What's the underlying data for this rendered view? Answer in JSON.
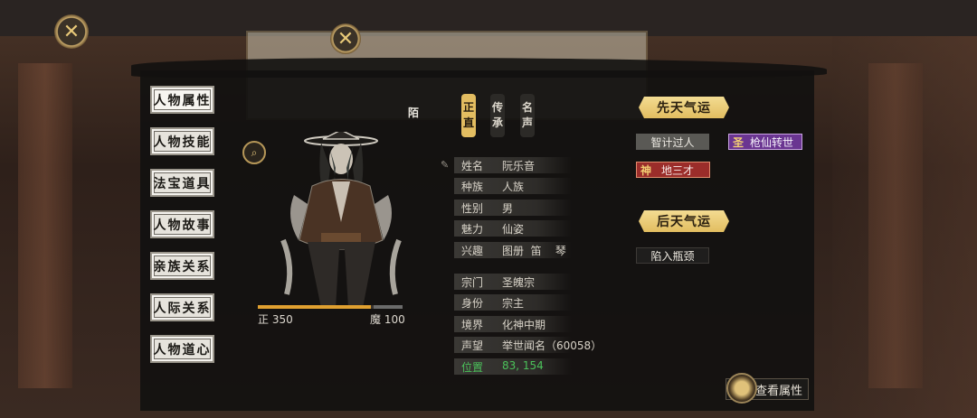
{
  "character": {
    "name_vertical": "陌",
    "righteous_stat": "正 350",
    "demonic_stat": "魔 100",
    "righteous_fraction": 0.78
  },
  "side_menu": [
    {
      "label": "人物属性",
      "active": true
    },
    {
      "label": "人物技能",
      "active": false
    },
    {
      "label": "法宝道具",
      "active": false
    },
    {
      "label": "人物故事",
      "active": false
    },
    {
      "label": "亲族关系",
      "active": false
    },
    {
      "label": "人际关系",
      "active": false
    },
    {
      "label": "人物道心",
      "active": false
    }
  ],
  "tabs": [
    {
      "label": "正直",
      "active": true
    },
    {
      "label": "传承",
      "active": false
    },
    {
      "label": "名声",
      "active": false
    }
  ],
  "info": {
    "basic": [
      {
        "key": "姓名",
        "value": "阮乐音"
      },
      {
        "key": "种族",
        "value": "人族"
      },
      {
        "key": "性别",
        "value": "男"
      },
      {
        "key": "魅力",
        "value": "仙姿"
      },
      {
        "key": "兴趣",
        "value": "图册  笛    琴"
      }
    ],
    "sect": [
      {
        "key": "宗门",
        "value": "圣魄宗"
      },
      {
        "key": "身份",
        "value": "宗主"
      },
      {
        "key": "境界",
        "value": "化神中期"
      },
      {
        "key": "声望",
        "value": "举世闻名（60058）"
      },
      {
        "key": "位置",
        "value": "83, 154"
      }
    ]
  },
  "fortune": {
    "innate_title": "先天气运",
    "innate_traits": [
      {
        "label": "智计过人",
        "style": "grey",
        "badge": ""
      },
      {
        "label": "枪仙转世",
        "style": "purple",
        "badge": "圣"
      },
      {
        "label": "地三才",
        "style": "red",
        "badge": "神"
      }
    ],
    "acquired_title": "后天气运",
    "acquired_traits": [
      {
        "label": "陷入瓶颈",
        "style": "dark",
        "badge": ""
      }
    ]
  },
  "buttons": {
    "view_attributes": "查看属性"
  },
  "colors": {
    "accent_gold": "#e3bd61",
    "position_green": "#4bc15a",
    "panel_bg": "#121110"
  }
}
